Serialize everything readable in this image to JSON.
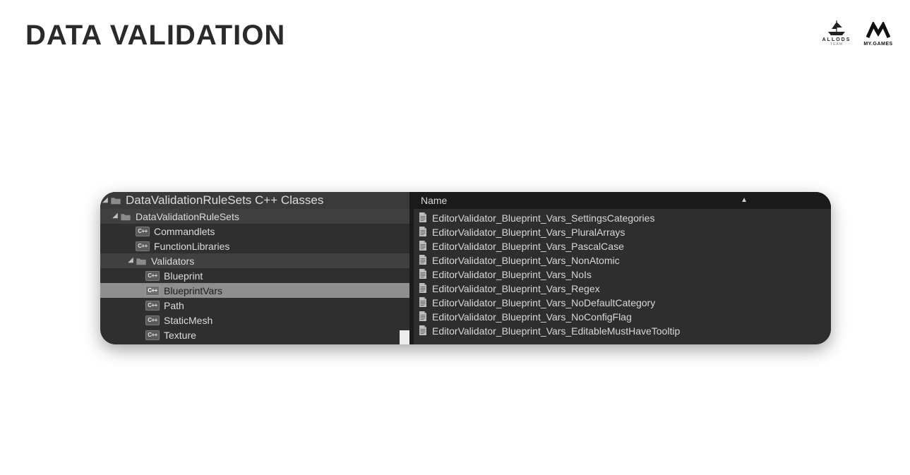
{
  "slide": {
    "title": "DATA VALIDATION",
    "logos": {
      "allods_label": "ALLODS",
      "allods_sub": "TEAM",
      "mygames_label": "MY.GAMES"
    }
  },
  "tree": {
    "root": {
      "label": "DataValidationRuleSets C++ Classes"
    },
    "nodes": [
      {
        "label": "DataValidationRuleSets",
        "indent": 1,
        "type": "folder",
        "expanded": true,
        "highlight": true,
        "selected": false
      },
      {
        "label": "Commandlets",
        "indent": 2,
        "type": "cpp",
        "expanded": false
      },
      {
        "label": "FunctionLibraries",
        "indent": 2,
        "type": "cpp",
        "expanded": false
      },
      {
        "label": "Validators",
        "indent": 2,
        "type": "folder",
        "expanded": true,
        "highlight": true
      },
      {
        "label": "Blueprint",
        "indent": 3,
        "type": "cpp",
        "expanded": false
      },
      {
        "label": "BlueprintVars",
        "indent": 3,
        "type": "cpp",
        "expanded": false,
        "selected": true
      },
      {
        "label": "Path",
        "indent": 3,
        "type": "cpp",
        "expanded": false
      },
      {
        "label": "StaticMesh",
        "indent": 3,
        "type": "cpp",
        "expanded": false
      },
      {
        "label": "Texture",
        "indent": 3,
        "type": "cpp",
        "expanded": false
      }
    ]
  },
  "list": {
    "header": "Name",
    "items": [
      "EditorValidator_Blueprint_Vars_SettingsCategories",
      "EditorValidator_Blueprint_Vars_PluralArrays",
      "EditorValidator_Blueprint_Vars_PascalCase",
      "EditorValidator_Blueprint_Vars_NonAtomic",
      "EditorValidator_Blueprint_Vars_NoIs",
      "EditorValidator_Blueprint_Vars_Regex",
      "EditorValidator_Blueprint_Vars_NoDefaultCategory",
      "EditorValidator_Blueprint_Vars_NoConfigFlag",
      "EditorValidator_Blueprint_Vars_EditableMustHaveTooltip"
    ]
  },
  "icons": {
    "cpp_badge": "C++"
  }
}
